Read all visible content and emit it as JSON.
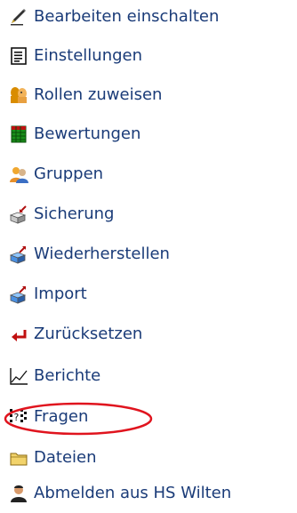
{
  "menu": {
    "items": [
      {
        "label": "Bearbeiten einschalten",
        "icon": "edit-pencil-icon"
      },
      {
        "label": "Einstellungen",
        "icon": "settings-document-icon"
      },
      {
        "label": "Rollen zuweisen",
        "icon": "roles-people-icon"
      },
      {
        "label": "Bewertungen",
        "icon": "grades-table-icon"
      },
      {
        "label": "Gruppen",
        "icon": "groups-users-icon"
      },
      {
        "label": "Sicherung",
        "icon": "backup-box-icon"
      },
      {
        "label": "Wiederherstellen",
        "icon": "restore-box-icon"
      },
      {
        "label": "Import",
        "icon": "import-box-icon"
      },
      {
        "label": "Zurücksetzen",
        "icon": "reset-arrow-icon"
      },
      {
        "label": "Berichte",
        "icon": "reports-chart-icon"
      },
      {
        "label": "Fragen",
        "icon": "questions-icon"
      },
      {
        "label": "Dateien",
        "icon": "folder-icon"
      },
      {
        "label": "Abmelden aus HS Wilten",
        "icon": "unenrol-user-icon"
      }
    ]
  },
  "colors": {
    "link_text": "#1a3b78",
    "highlight_ring": "#e0141e"
  }
}
